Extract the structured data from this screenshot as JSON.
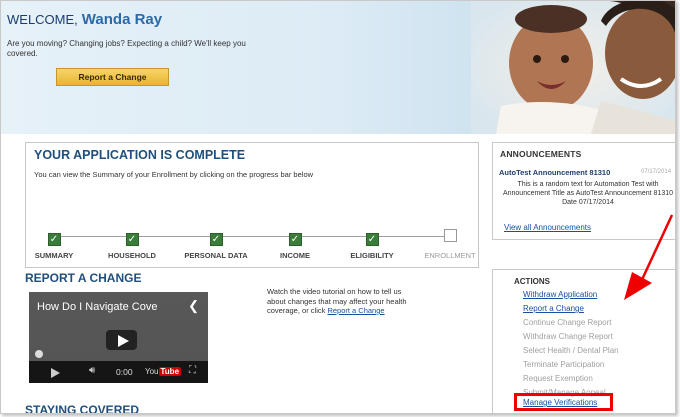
{
  "banner": {
    "welcome": "WELCOME,",
    "user_name": "Wanda Ray",
    "intro": "Are you moving? Changing jobs? Expecting a child? We'll keep you covered.",
    "report_button": "Report a Change"
  },
  "application": {
    "title": "YOUR APPLICATION IS COMPLETE",
    "description": "You can view the Summary of your Enrollment by clicking on the progress bar below",
    "steps": [
      {
        "label": "SUMMARY",
        "complete": true
      },
      {
        "label": "HOUSEHOLD",
        "complete": true
      },
      {
        "label": "PERSONAL DATA",
        "complete": true
      },
      {
        "label": "INCOME",
        "complete": true
      },
      {
        "label": "ELIGIBILITY",
        "complete": true
      },
      {
        "label": "ENROLLMENT",
        "complete": false
      }
    ]
  },
  "report_change": {
    "title": "REPORT A CHANGE",
    "video_title": "How Do I Navigate Cove",
    "video_time": "0:00",
    "video_brand": "You",
    "video_brand_tube": "Tube",
    "text_before": "Watch the video tutorial on how to tell us about changes that may affect your health coverage, or click ",
    "link": "Report a Change"
  },
  "staying_covered": {
    "title": "STAYING COVERED"
  },
  "announcements": {
    "title": "ANNOUNCEMENTS",
    "item_title": "AutoTest Announcement 81310",
    "item_date": "07/17/2014",
    "item_body": "This is a random text for Automation Test with Announcement Title as AutoTest Announcement 81310 Date 07/17/2014",
    "view_all": "View all Announcements"
  },
  "actions": {
    "title": "ACTIONS",
    "items": [
      {
        "label": "Withdraw Application",
        "enabled": true
      },
      {
        "label": "Report a Change",
        "enabled": true
      },
      {
        "label": "Continue Change Report",
        "enabled": false
      },
      {
        "label": "Withdraw Change Report",
        "enabled": false
      },
      {
        "label": "Select Health / Dental Plan",
        "enabled": false
      },
      {
        "label": "Terminate Participation",
        "enabled": false
      },
      {
        "label": "Request Exemption",
        "enabled": false
      },
      {
        "label": "Submit/Manage Appeal",
        "enabled": false
      },
      {
        "label": "Manage Verifications",
        "enabled": true
      }
    ]
  },
  "colors": {
    "heading": "#1f4f7d",
    "link": "#1a4fa0",
    "check": "#3a7d3a",
    "highlight": "#e00000",
    "button": "#f0c24a"
  }
}
